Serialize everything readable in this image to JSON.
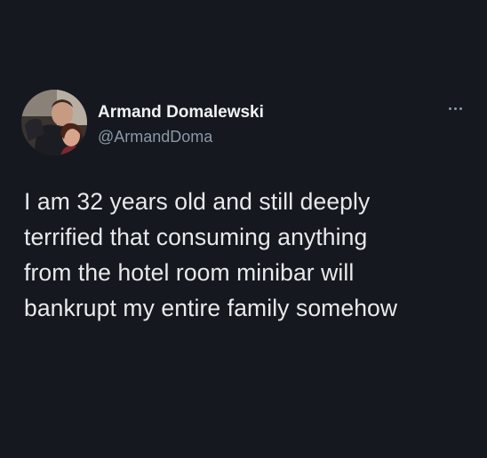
{
  "author": {
    "display_name": "Armand Domalewski",
    "handle": "@ArmandDoma",
    "avatar_icon": "profile-photo-avatar"
  },
  "menu": {
    "icon": "more-options-icon"
  },
  "tweet": {
    "text_lines": [
      "I am 32 years old and still deeply",
      "terrified that consuming anything",
      "from the hotel room minibar will",
      "bankrupt my entire family somehow"
    ]
  },
  "colors": {
    "background": "#15181f",
    "text_primary": "#e7e9ea",
    "text_secondary": "#8b98a5"
  }
}
